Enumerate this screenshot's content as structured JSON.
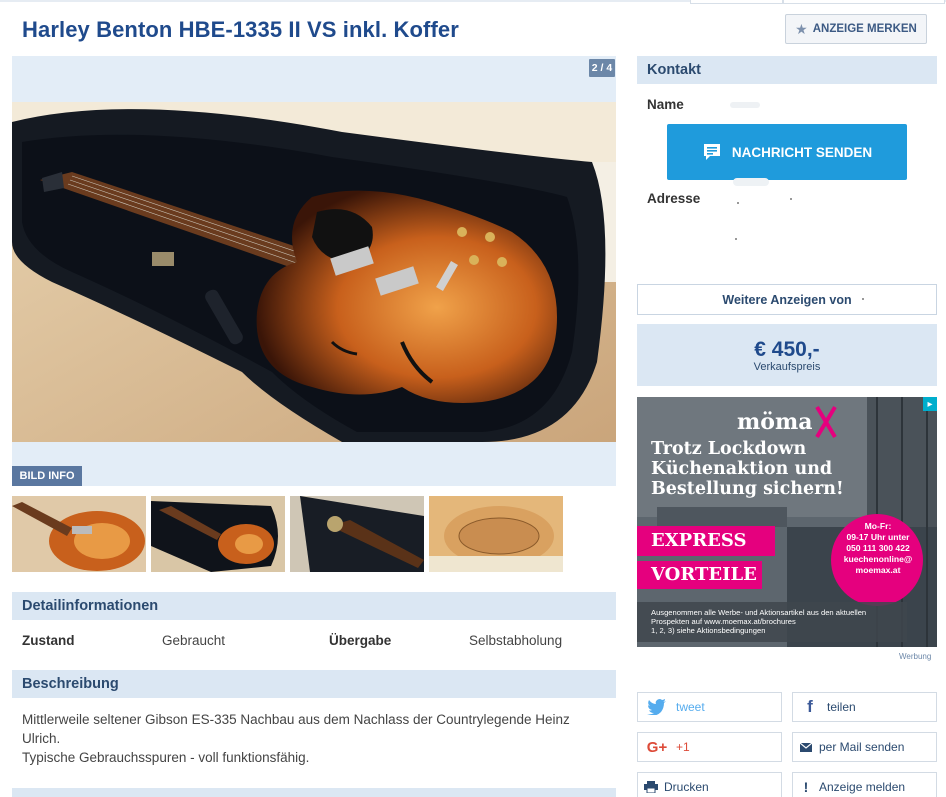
{
  "ad_listing": {
    "title": "Harley Benton HBE-1335 II VS inkl. Koffer",
    "merken_label": "ANZEIGE MERKEN"
  },
  "gallery": {
    "counter": "2 / 4",
    "bildinfo_label": "BILD INFO"
  },
  "details": {
    "heading": "Detailinformationen",
    "items": [
      {
        "label": "Zustand",
        "value": "Gebraucht"
      },
      {
        "label": "Übergabe",
        "value": "Selbstabholung"
      }
    ]
  },
  "description": {
    "heading": "Beschreibung",
    "lines": [
      "Mittlerweile seltener Gibson ES-335 Nachbau aus dem Nachlass der Countrylegende Heinz Ulrich.",
      "Typische Gebrauchsspuren - voll funktionsfähig."
    ]
  },
  "contact": {
    "heading": "Kontakt",
    "name_label": "Name",
    "message_button": "NACHRICHT SENDEN",
    "address_label": "Adresse",
    "more_ads_label": "Weitere Anzeigen von"
  },
  "price": {
    "amount": "€ 450,-",
    "label": "Verkaufspreis"
  },
  "advert": {
    "brand": "möma",
    "headline_lines": [
      "Trotz Lockdown",
      "Küchenaktion und",
      "Bestellung sichern!"
    ],
    "badge_lines": [
      "Mo-Fr:",
      "09-17 Uhr unter",
      "050 111 300 422",
      "kuechenonline@",
      "moemax.at"
    ],
    "express": "EXPRESS",
    "vorteile": "VORTEILE",
    "fineprint_lines": [
      "Ausgenommen alle Werbe- und Aktionsartikel aus den aktuellen",
      "Prospekten auf www.moemax.at/brochures",
      "1, 2, 3) siehe Aktionsbedingungen"
    ],
    "werbung_label": "Werbung",
    "colors": {
      "magenta": "#e5007e",
      "dark": "#3b444c"
    }
  },
  "share": {
    "tweet": "tweet",
    "teilen": "teilen",
    "gplus": "+1",
    "mail": "per Mail senden",
    "drucken": "Drucken",
    "melden": "Anzeige melden"
  },
  "colors": {
    "title_blue": "#1f4a8c",
    "section_bg": "#dbe7f3",
    "button_blue": "#1f9bdc"
  }
}
